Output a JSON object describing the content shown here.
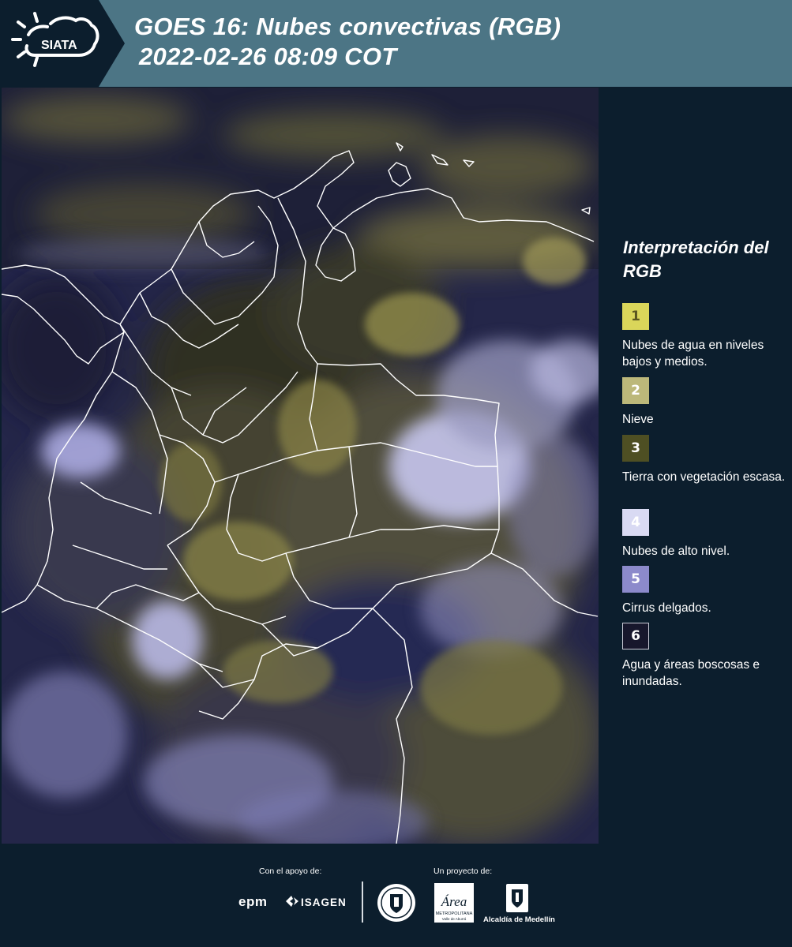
{
  "header": {
    "logo_text": "SIATA",
    "title_line1": "GOES 16: Nubes convectivas (RGB)",
    "title_line2": "2022-02-26 08:09 COT",
    "colors": {
      "header_band": "#4c7585",
      "logo_block": "#0c1e2d"
    }
  },
  "map": {
    "image_type": "satellite-rgb-composite",
    "colors": {
      "deep_convection": "#c3c1ef",
      "low_clouds": "#a6a05a",
      "land": "#35341e",
      "water": "#1e1f3e"
    }
  },
  "legend": {
    "title": "Interpretación del RGB",
    "items": [
      {
        "number": "1",
        "label": "Nubes de agua en niveles bajos y medios.",
        "color": "#dad65a",
        "text_color": "#5a5520"
      },
      {
        "number": "2",
        "label": "Nieve",
        "color": "#bcb87a",
        "text_color": "#ffffff"
      },
      {
        "number": "3",
        "label": "Tierra con vegetación escasa.",
        "color": "#4e4f23",
        "text_color": "#ffffff"
      },
      {
        "number": "4",
        "label": "Nubes de alto nivel.",
        "color": "#d9daf3",
        "text_color": "#ffffff"
      },
      {
        "number": "5",
        "label": "Cirrus delgados.",
        "color": "#8c8acb",
        "text_color": "#ffffff"
      },
      {
        "number": "6",
        "label": "Agua y áreas boscosas e inundadas.",
        "color": "#17172c",
        "text_color": "#ffffff"
      }
    ]
  },
  "footer": {
    "support_label": "Con el apoyo de:",
    "project_label": "Un proyecto de:",
    "sponsors": [
      "epm",
      "ISAGEN"
    ],
    "area_metropolitana_text": "Área",
    "area_metropolitana_sub": "METROPOLITANA",
    "area_metropolitana_sub2": "Valle de Aburrá",
    "alcaldia_text": "Alcaldía de Medellín"
  }
}
